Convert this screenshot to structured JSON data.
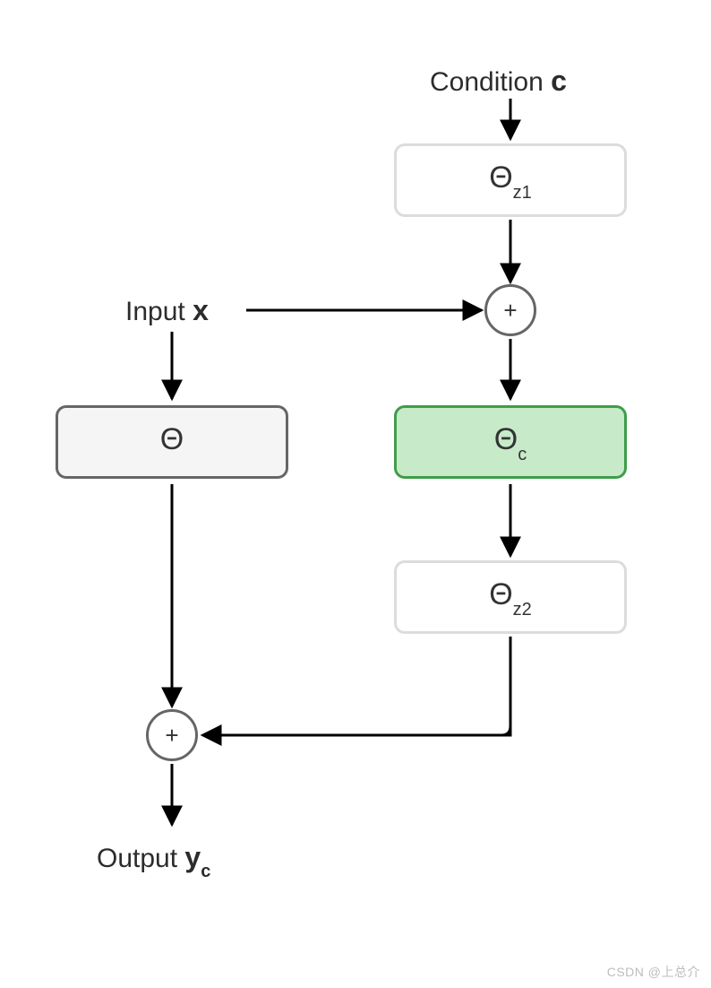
{
  "labels": {
    "condition_prefix": "Condition ",
    "condition_var": "c",
    "input_prefix": "Input ",
    "input_var": "x",
    "output_prefix": "Output ",
    "output_var": "y",
    "output_sub": "c"
  },
  "boxes": {
    "theta_z1": {
      "base": "Θ",
      "sub": "z1"
    },
    "theta": {
      "base": "Θ",
      "sub": ""
    },
    "theta_c": {
      "base": "Θ",
      "sub": "c"
    },
    "theta_z2": {
      "base": "Θ",
      "sub": "z2"
    }
  },
  "ops": {
    "plus_top": "+",
    "plus_bottom": "+"
  },
  "colors": {
    "box_grey_border": "#666666",
    "box_grey_fill": "#f5f5f5",
    "box_light_border": "#dcdcdc",
    "box_light_fill": "#ffffff",
    "box_green_border": "#3f9d4a",
    "box_green_fill": "#c7ebc9",
    "arrow": "#000000"
  },
  "watermark": "CSDN @上总介"
}
